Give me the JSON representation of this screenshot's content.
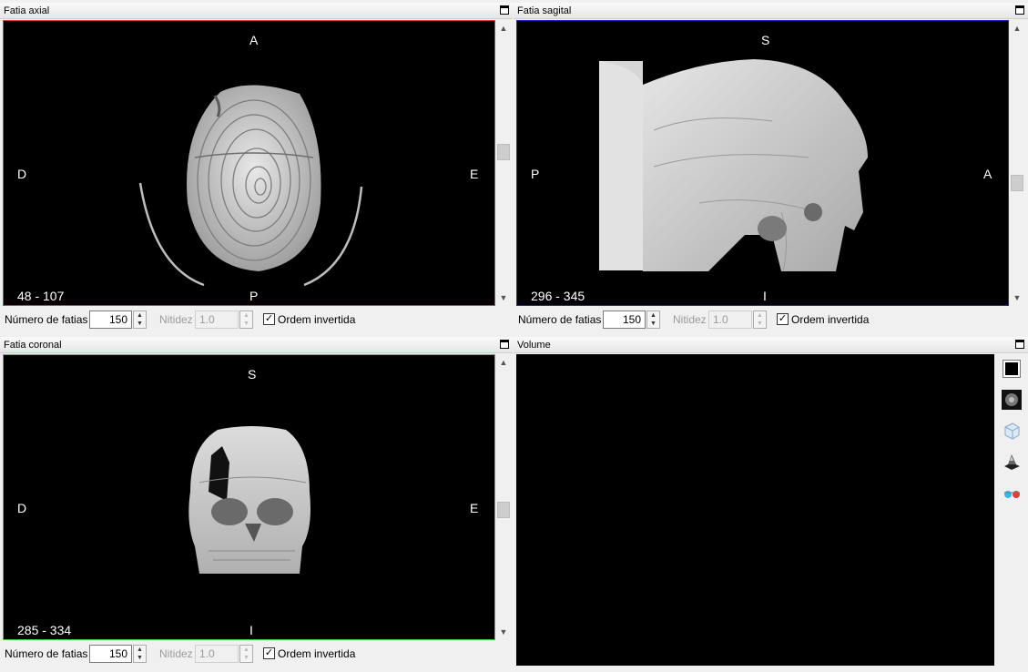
{
  "axial": {
    "title": "Fatia axial",
    "top": "A",
    "bottom": "P",
    "left": "D",
    "right": "E",
    "range": "48 - 107",
    "border_color": "#e03c3c",
    "slices_label": "Número de fatias",
    "slices_value": "150",
    "sharpness_label": "Nitidez",
    "sharpness_value": "1.0",
    "invert_label": "Ordem invertida"
  },
  "sagittal": {
    "title": "Fatia sagital",
    "top": "S",
    "bottom": "I",
    "left": "P",
    "right": "A",
    "range": "296 - 345",
    "border_color": "#2828c8",
    "slices_label": "Número de fatias",
    "slices_value": "150",
    "sharpness_label": "Nitidez",
    "sharpness_value": "1.0",
    "invert_label": "Ordem invertida"
  },
  "coronal": {
    "title": "Fatia coronal",
    "top": "S",
    "bottom": "I",
    "left": "D",
    "right": "E",
    "range": "285 - 334",
    "border_color": "#3ccf3c",
    "slices_label": "Número de fatias",
    "slices_value": "150",
    "sharpness_label": "Nitidez",
    "sharpness_value": "1.0",
    "invert_label": "Ordem invertida"
  },
  "volume": {
    "title": "Volume",
    "tools": [
      "background-color-icon",
      "raycasting-icon",
      "slice-plane-icon",
      "3d-surface-icon",
      "stereo-glasses-icon"
    ]
  }
}
